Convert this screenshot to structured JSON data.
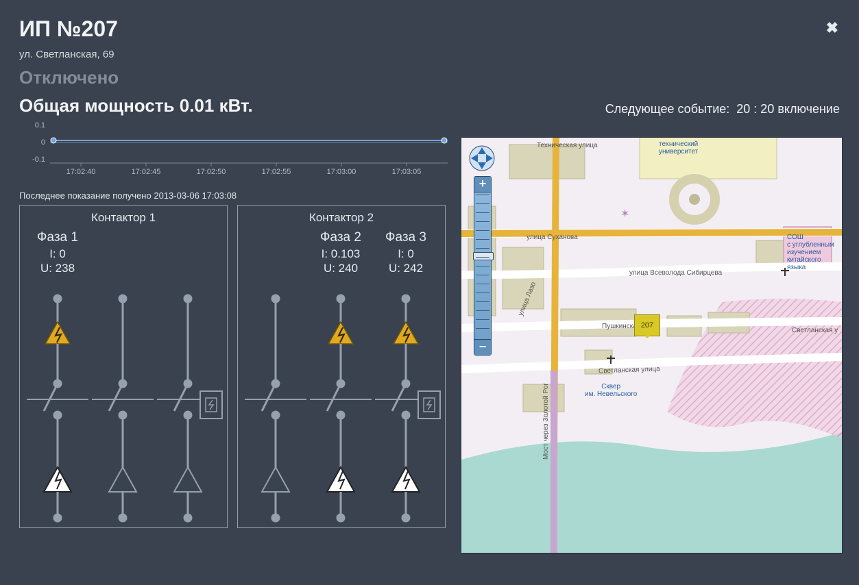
{
  "header": {
    "title": "ИП №207",
    "address": "ул. Светланская, 69",
    "status": "Отключено",
    "close_glyph": "✖"
  },
  "power": {
    "label_prefix": "Общая мощность ",
    "value": "0.01",
    "unit": " кВт."
  },
  "next_event": {
    "label": "Следующее событие:",
    "time": "20 : 20",
    "action": "включение"
  },
  "chart_data": {
    "type": "line",
    "title": "",
    "xlabel": "",
    "ylabel": "",
    "ylim": [
      -0.1,
      0.1
    ],
    "y_ticks": [
      "0.1",
      "0",
      "-0.1"
    ],
    "x_ticks": [
      "17:02:40",
      "17:02:45",
      "17:02:50",
      "17:02:55",
      "17:03:00",
      "17:03:05"
    ],
    "x": [
      "17:02:38",
      "17:02:40",
      "17:02:45",
      "17:02:50",
      "17:02:55",
      "17:03:00",
      "17:03:05",
      "17:03:08"
    ],
    "values": [
      0.01,
      0.01,
      0.01,
      0.01,
      0.01,
      0.01,
      0.01,
      0.01
    ]
  },
  "last_reading": {
    "prefix": "Последнее показание получено ",
    "timestamp": "2013-03-06 17:03:08"
  },
  "contactors": [
    {
      "title": "Контактор 1",
      "phases": [
        {
          "name": "Фаза 1",
          "I": "0",
          "U": "238",
          "warn": true,
          "surge": true
        },
        {
          "name": "",
          "I": "",
          "U": "",
          "warn": false,
          "surge": false
        },
        {
          "name": "",
          "I": "",
          "U": "",
          "warn": false,
          "surge": false
        }
      ]
    },
    {
      "title": "Контактор 2",
      "phases": [
        {
          "name": "",
          "I": "",
          "U": "",
          "warn": false,
          "surge": false
        },
        {
          "name": "Фаза 2",
          "I": "0.103",
          "U": "240",
          "warn": true,
          "surge": true
        },
        {
          "name": "Фаза 3",
          "I": "0",
          "U": "242",
          "warn": true,
          "surge": true
        }
      ]
    }
  ],
  "map": {
    "marker_label": "207",
    "streets": {
      "tech_univ": "технический\nуниверситет",
      "tech_st": "Техническая улица",
      "sukhanov": "улица Суханова",
      "lazo": "улица Лазо",
      "sibirtsev": "улица Всеволода Сибирцева",
      "pushkin": "Пушкинская",
      "svetlan": "Светланская улица",
      "svetlan_e": "Светланская у",
      "bridge": "Мост через Золотой Рог",
      "skver": "Сквер\nим. Невельского",
      "school": "СОШ\nс углубленным\nизучением\nкитайского\nязыка"
    },
    "zoom": {
      "plus": "+",
      "minus": "−"
    }
  },
  "icons": {
    "warn": "lightning-warning-icon",
    "surge": "surge-arrow-icon",
    "coil": "relay-coil-icon"
  }
}
